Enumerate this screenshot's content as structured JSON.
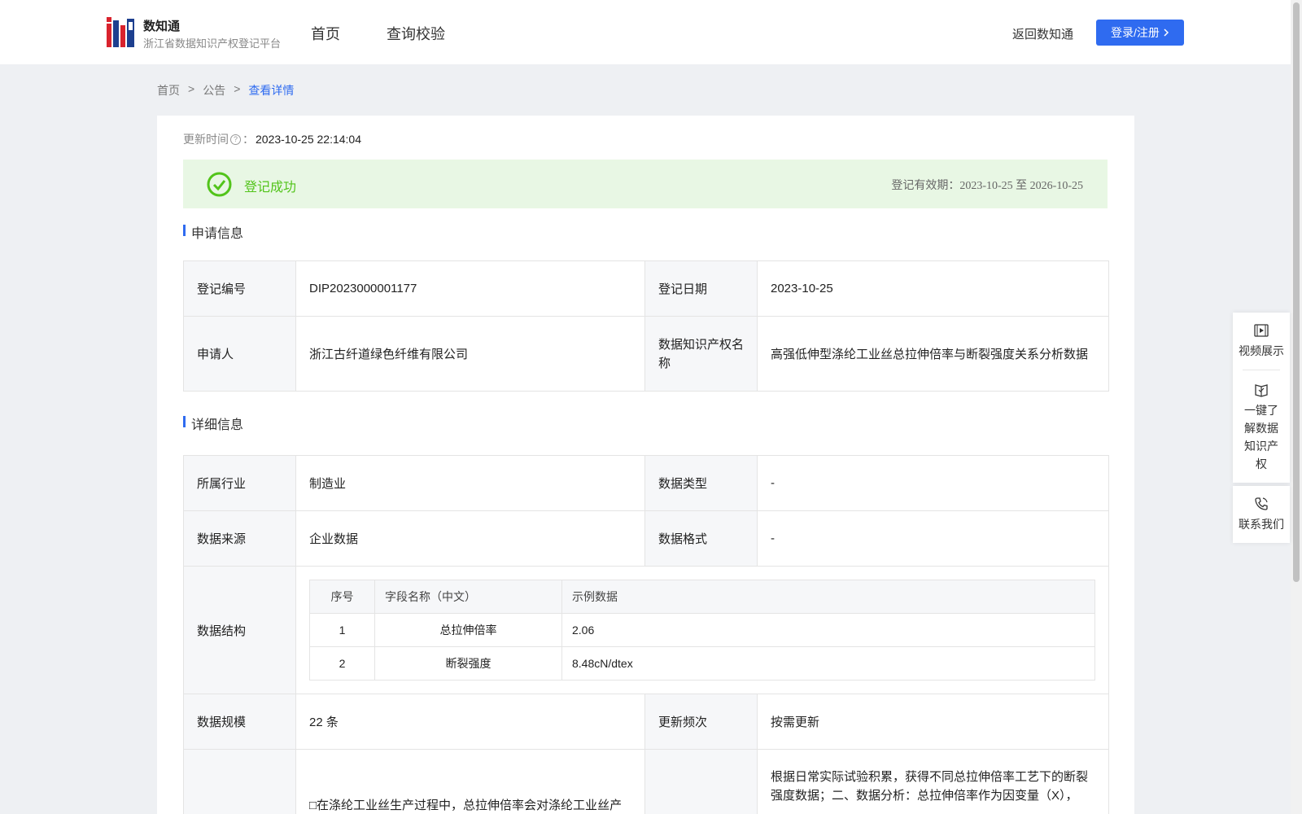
{
  "header": {
    "brand_name": "数知通",
    "brand_sub": "浙江省数据知识产权登记平台",
    "nav": [
      "首页",
      "查询校验"
    ],
    "return_link": "返回数知通",
    "login_label": "登录/注册"
  },
  "breadcrumb": [
    "首页",
    ">",
    "公告",
    ">",
    "查看详情"
  ],
  "update": {
    "label": "更新时间",
    "colon": "：",
    "value": "2023-10-25 22:14:04"
  },
  "status": {
    "text": "登记成功",
    "validity_label": "登记有效期：",
    "validity_dates": "2023-10-25 至 2026-10-25",
    "color": "#52c41a"
  },
  "application": {
    "title": "申请信息",
    "reg_no_label": "登记编号",
    "reg_no": "DIP2023000001177",
    "reg_date_label": "登记日期",
    "reg_date": "2023-10-25",
    "applicant_label": "申请人",
    "applicant": "浙江古纤道绿色纤维有限公司",
    "ip_name_label": "数据知识产权名称",
    "ip_name": "高强低伸型涤纶工业丝总拉伸倍率与断裂强度关系分析数据"
  },
  "detail": {
    "title": "详细信息",
    "industry_label": "所属行业",
    "industry": "制造业",
    "data_type_label": "数据类型",
    "data_type": "-",
    "source_label": "数据来源",
    "source": "企业数据",
    "format_label": "数据格式",
    "format": "-",
    "structure_label": "数据结构",
    "structure": {
      "headers": [
        "序号",
        "字段名称（中文）",
        "示例数据"
      ],
      "rows": [
        [
          "1",
          "总拉伸倍率",
          "2.06"
        ],
        [
          "2",
          "断裂强度",
          "8.48cN/dtex"
        ]
      ]
    },
    "scale_label": "数据规模",
    "scale": "22 条",
    "frequency_label": "更新频次",
    "frequency": "按需更新",
    "desc_left": "□在涤纶工业丝生产过程中，总拉伸倍率会对涤纶工业丝产",
    "desc_right": "根据日常实际试验积累，获得不同总拉伸倍率工艺下的断裂强度数据；二、数据分析：总拉伸倍率作为因变量（X），"
  },
  "side": {
    "video": "视频展示",
    "learn": "一键了解数据知识产权",
    "contact": "联系我们"
  },
  "colors": {
    "primary": "#2f6bf0",
    "success_bg": "#e8f7e4"
  }
}
